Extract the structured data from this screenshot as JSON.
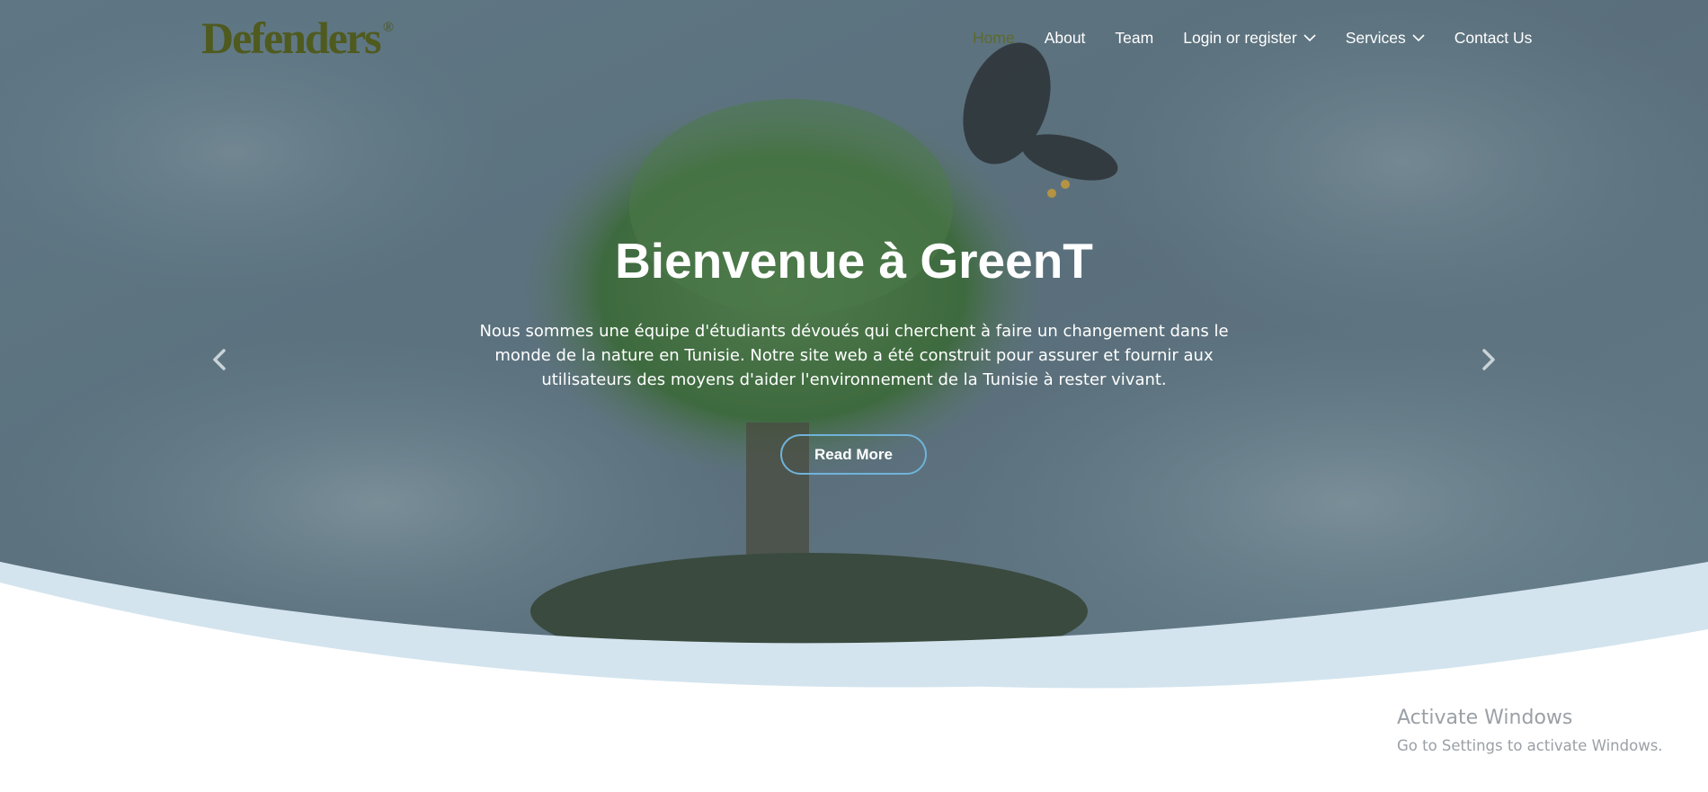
{
  "brand": {
    "name": "Defenders",
    "mark": "®"
  },
  "nav": {
    "items": [
      {
        "label": "Home",
        "active": true
      },
      {
        "label": "About"
      },
      {
        "label": "Team"
      },
      {
        "label": "Login or register",
        "dropdown": true
      },
      {
        "label": "Services",
        "dropdown": true
      },
      {
        "label": "Contact Us"
      }
    ]
  },
  "hero": {
    "title": "Bienvenue à GreenT",
    "text": "Nous sommes une équipe d'étudiants dévoués qui cherchent à faire un changement dans le monde de la nature en Tunisie. Notre site web a été construit pour assurer et fournir aux utilisateurs des moyens d'aider l'environnement de la Tunisie à rester vivant.",
    "button": "Read More"
  },
  "carousel": {
    "prev_icon": "chevron-left-icon",
    "next_icon": "chevron-right-icon"
  },
  "watermark": {
    "title": "Activate Windows",
    "subtitle": "Go to Settings to activate Windows."
  },
  "colors": {
    "overlay": "#56707f",
    "wave": "#d3e4ee",
    "accent": "#6fb3d9",
    "logo": "#4f5a1e"
  }
}
